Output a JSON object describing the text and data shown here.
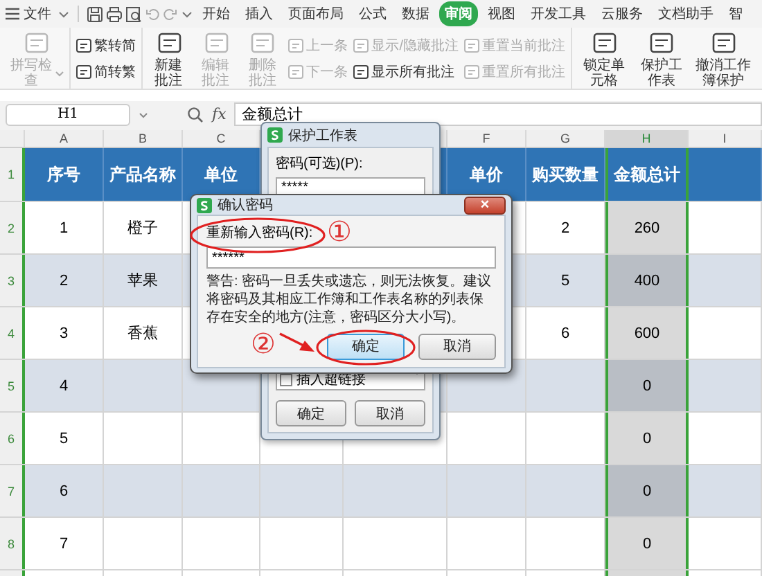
{
  "menu": {
    "file": "文件",
    "tabs": [
      {
        "label": "开始",
        "selected": false
      },
      {
        "label": "插入",
        "selected": false
      },
      {
        "label": "页面布局",
        "selected": false
      },
      {
        "label": "公式",
        "selected": false
      },
      {
        "label": "数据",
        "selected": false
      },
      {
        "label": "审阅",
        "selected": true
      },
      {
        "label": "视图",
        "selected": false
      },
      {
        "label": "开发工具",
        "selected": false
      },
      {
        "label": "云服务",
        "selected": false
      },
      {
        "label": "文档助手",
        "selected": false
      },
      {
        "label": "智",
        "selected": false
      }
    ]
  },
  "ribbon": {
    "groups": [
      {
        "items": [
          {
            "kind": "large",
            "label": "拼写检查",
            "disabled": true,
            "dropdown": true
          }
        ]
      },
      {
        "items": [
          {
            "kind": "stack",
            "rows": [
              {
                "label": "繁转简",
                "disabled": false
              },
              {
                "label": "简转繁",
                "disabled": false
              }
            ]
          }
        ]
      },
      {
        "items": [
          {
            "kind": "large",
            "label": "新建批注",
            "disabled": false,
            "dropdown": false
          },
          {
            "kind": "large",
            "label": "编辑批注",
            "disabled": true,
            "dropdown": false
          },
          {
            "kind": "large",
            "label": "删除批注",
            "disabled": true,
            "dropdown": false
          },
          {
            "kind": "stack",
            "rows": [
              {
                "label": "上一条",
                "disabled": true
              },
              {
                "label": "下一条",
                "disabled": true
              }
            ]
          },
          {
            "kind": "stack",
            "rows": [
              {
                "label": "显示/隐藏批注",
                "disabled": true
              },
              {
                "label": "显示所有批注",
                "disabled": false
              }
            ]
          },
          {
            "kind": "stack",
            "rows": [
              {
                "label": "重置当前批注",
                "disabled": true
              },
              {
                "label": "重置所有批注",
                "disabled": true
              }
            ]
          }
        ]
      },
      {
        "items": [
          {
            "kind": "large",
            "label": "锁定单元格",
            "disabled": false,
            "dropdown": false
          },
          {
            "kind": "large",
            "label": "保护工作表",
            "disabled": false,
            "dropdown": false
          },
          {
            "kind": "large",
            "label": "撤消工作簿保护",
            "disabled": false,
            "dropdown": false
          }
        ]
      }
    ]
  },
  "formula_bar": {
    "cell_ref": "H1",
    "fx": "fx",
    "value": "金额总计"
  },
  "sheet": {
    "columns": [
      {
        "label": "A",
        "selected": false
      },
      {
        "label": "B",
        "selected": false
      },
      {
        "label": "C",
        "selected": false
      },
      {
        "label": "F",
        "selected": false
      },
      {
        "label": "G",
        "selected": false
      },
      {
        "label": "H",
        "selected": true
      },
      {
        "label": "I",
        "selected": false
      }
    ],
    "rows": [
      {
        "number": "1",
        "kind": "header",
        "banded": false,
        "cells": {
          "seq": "序号",
          "product": "产品名称",
          "unit": "单位",
          "price": "单价",
          "qty": "购买数量",
          "total": "金额总计"
        }
      },
      {
        "number": "2",
        "kind": "data",
        "banded": false,
        "cells": {
          "seq": "1",
          "product": "橙子",
          "qty": "2",
          "total": "260"
        }
      },
      {
        "number": "3",
        "kind": "data",
        "banded": true,
        "cells": {
          "seq": "2",
          "product": "苹果",
          "qty": "5",
          "total": "400"
        }
      },
      {
        "number": "4",
        "kind": "data",
        "banded": false,
        "cells": {
          "seq": "3",
          "product": "香蕉",
          "qty": "6",
          "total": "600"
        }
      },
      {
        "number": "5",
        "kind": "data",
        "banded": true,
        "cells": {
          "seq": "4",
          "total": "0"
        }
      },
      {
        "number": "6",
        "kind": "data",
        "banded": false,
        "cells": {
          "seq": "5",
          "total": "0"
        }
      },
      {
        "number": "7",
        "kind": "data",
        "banded": true,
        "cells": {
          "seq": "6",
          "total": "0"
        }
      },
      {
        "number": "8",
        "kind": "data",
        "banded": false,
        "cells": {
          "seq": "7",
          "total": "0"
        }
      }
    ]
  },
  "protect_dialog": {
    "title": "保护工作表",
    "password_label": "密码(可选)(P):",
    "password_value": "*****",
    "options": [
      {
        "label": "插入超链接",
        "checked": false
      }
    ],
    "buttons": [
      "确定",
      "取消"
    ]
  },
  "confirm_dialog": {
    "title": "确认密码",
    "close": "×",
    "label": "重新输入密码(R):",
    "password_value": "******",
    "warning": "警告: 密码一旦丢失或遗忘，则无法恢复。建议将密码及其相应工作簿和工作表名称的列表保存在安全的地方(注意，密码区分大小写)。",
    "buttons": [
      {
        "label": "确定",
        "focused": true
      },
      {
        "label": "取消",
        "focused": false
      }
    ]
  },
  "annotations": {
    "steps": [
      {
        "label": "①"
      },
      {
        "label": "②"
      }
    ]
  }
}
